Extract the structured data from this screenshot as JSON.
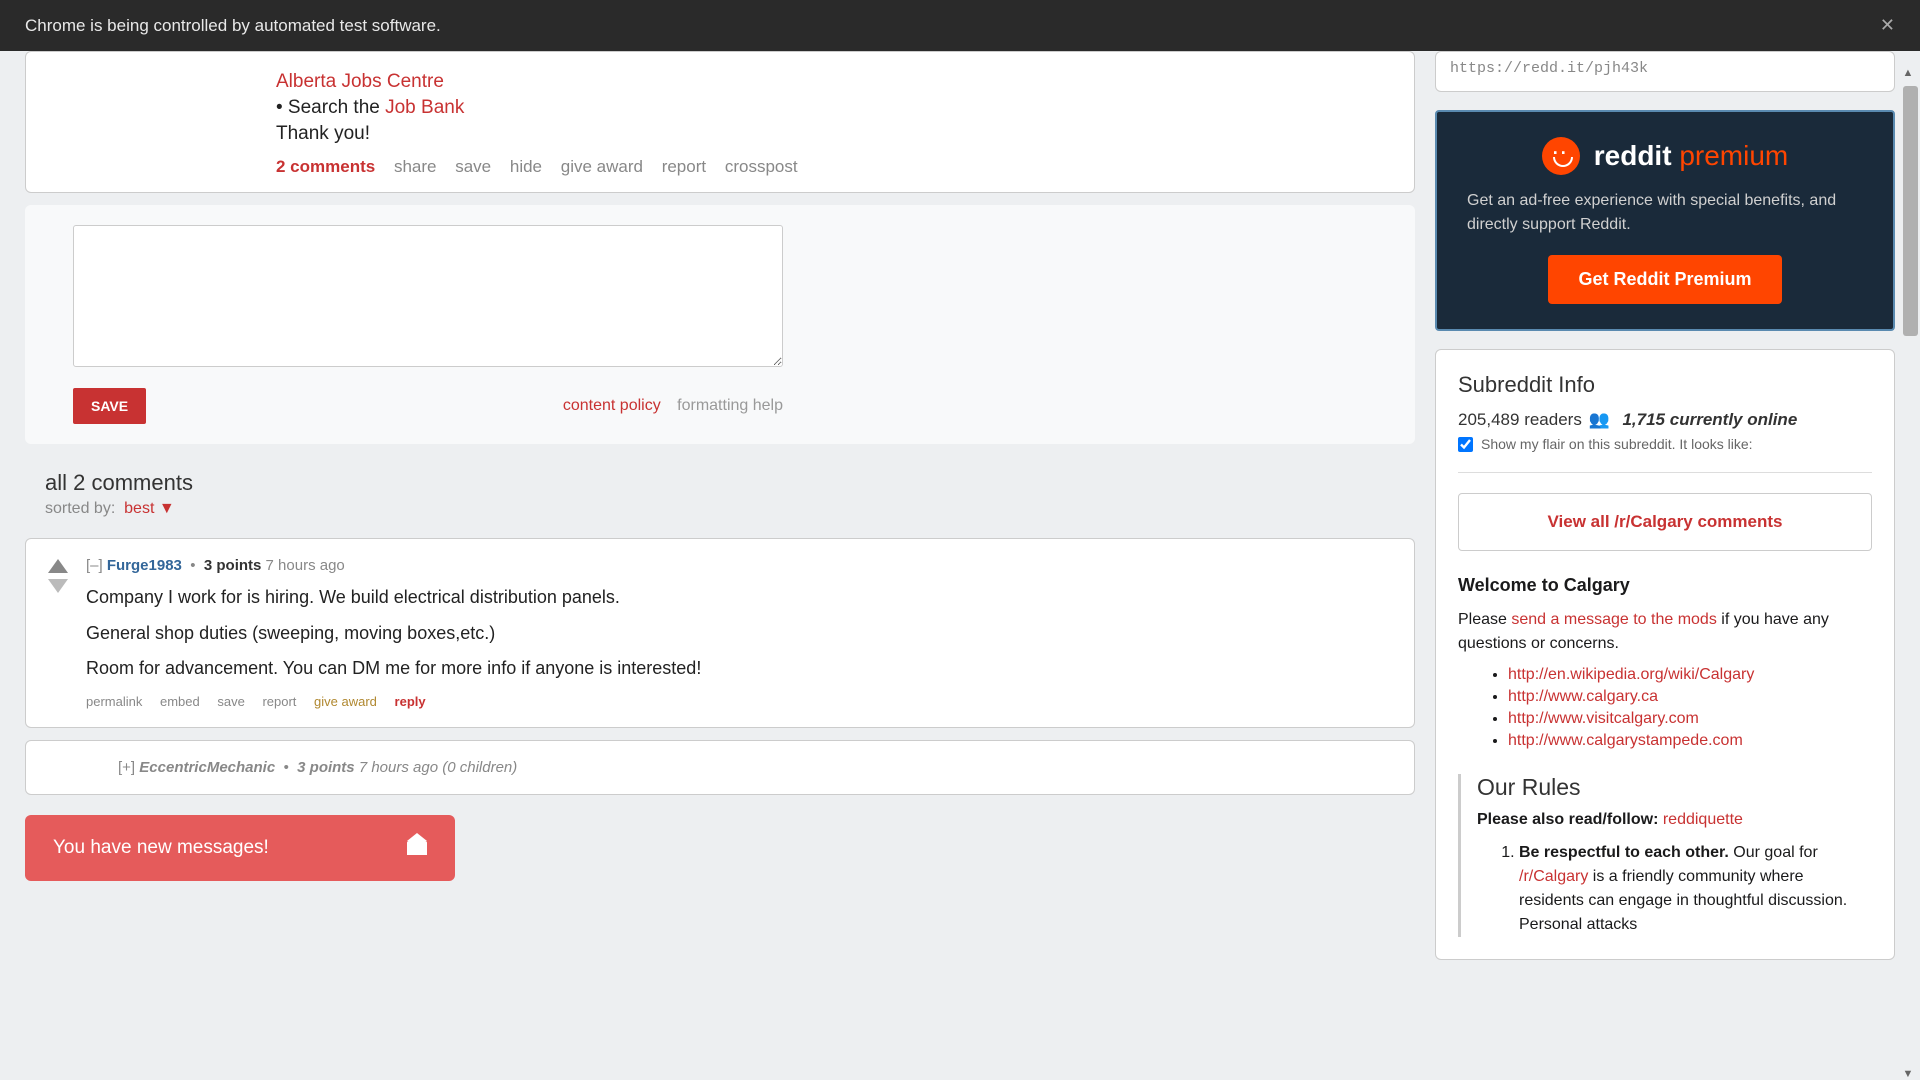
{
  "banner": {
    "text": "Chrome is being controlled by automated test software.",
    "close": "✕"
  },
  "post": {
    "link1_prefix": "",
    "link1": "Alberta Jobs Centre",
    "line2_prefix": "• Search the ",
    "link2": "Job Bank",
    "thanks": "Thank you!",
    "actions": {
      "comments": "2 comments",
      "share": "share",
      "save": "save",
      "hide": "hide",
      "give_award": "give award",
      "report": "report",
      "crosspost": "crosspost"
    }
  },
  "form": {
    "save": "SAVE",
    "content_policy": "content policy",
    "formatting_help": "formatting help"
  },
  "comments_header": {
    "title": "all 2 comments",
    "sorted_label": "sorted by:",
    "sort_value": "best ▼"
  },
  "comment1": {
    "collapse": "[–]",
    "user": "Furge1983",
    "dot": "•",
    "points": "3 points",
    "time": "7 hours ago",
    "p1": "Company I work for is hiring. We build electrical distribution panels.",
    "p2": "General shop duties (sweeping, moving boxes,etc.)",
    "p3": "Room for advancement. You can DM me for more info if anyone is interested!",
    "actions": {
      "permalink": "permalink",
      "embed": "embed",
      "save": "save",
      "report": "report",
      "give_award": "give award",
      "reply": "reply"
    }
  },
  "comment2": {
    "expand": "[+]",
    "user": "EccentricMechanic",
    "dot": "•",
    "points": "3 points",
    "rest": "7 hours ago (0 children)"
  },
  "notif": {
    "text": "You have new messages!"
  },
  "sidebar": {
    "short_url": "https://redd.it/pjh43k",
    "premium": {
      "title_white": "reddit",
      "title_orange": "premium",
      "desc": "Get an ad-free experience with special benefits, and directly support Reddit.",
      "button": "Get Reddit Premium"
    },
    "info": {
      "heading": "Subreddit Info",
      "readers_num": "205,489",
      "readers_label": "readers",
      "online_num": "1,715",
      "online_label": "currently online",
      "flair_text": "Show my flair on this subreddit. It looks like:",
      "view_all": "View all /r/Calgary comments",
      "welcome_h": "Welcome to Calgary",
      "welcome_prefix": "Please ",
      "welcome_link": "send a message to the mods",
      "welcome_suffix": " if you have any questions or concerns.",
      "links": [
        "http://en.wikipedia.org/wiki/Calgary",
        "http://www.calgary.ca",
        "http://www.visitcalgary.com",
        "http://www.calgarystampede.com"
      ],
      "rules_title": "Our Rules",
      "rules_read_prefix": "Please also read/follow: ",
      "rules_read_link": "reddiquette",
      "rule1_bold": "Be respectful to each other.",
      "rule1_text_a": " Our goal for ",
      "rule1_link": "/r/Calgary",
      "rule1_text_b": " is a friendly community where residents can engage in thoughtful discussion. Personal attacks"
    }
  }
}
